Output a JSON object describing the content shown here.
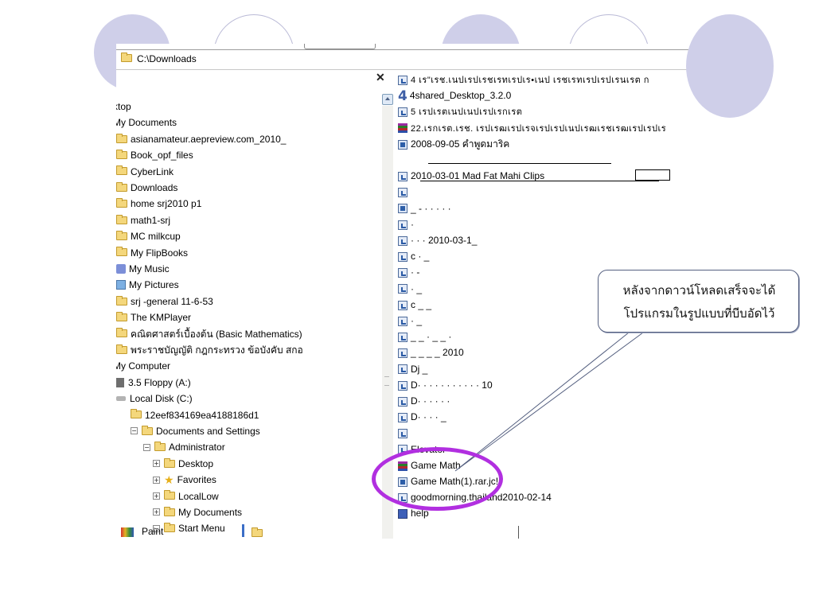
{
  "address_bar": {
    "path": "C:\\Downloads"
  },
  "left_pane": {
    "close_label": "✕",
    "tree": [
      {
        "label": "ktop",
        "icon": "none",
        "indent": 0
      },
      {
        "label": "My Documents",
        "icon": "none",
        "indent": 0
      },
      {
        "label": "asianamateur.aepreview.com_2010_",
        "icon": "folder-icon",
        "indent": 1
      },
      {
        "label": "Book_opf_files",
        "icon": "folder-icon",
        "indent": 1
      },
      {
        "label": "CyberLink",
        "icon": "folder-icon",
        "indent": 1
      },
      {
        "label": "Downloads",
        "icon": "folder-icon",
        "indent": 1
      },
      {
        "label": "home srj2010 p1",
        "icon": "folder-icon",
        "indent": 1
      },
      {
        "label": "math1-srj",
        "icon": "folder-icon",
        "indent": 1
      },
      {
        "label": "MC milkcup",
        "icon": "folder-icon",
        "indent": 1
      },
      {
        "label": "My FlipBooks",
        "icon": "folder-icon",
        "indent": 1
      },
      {
        "label": "My Music",
        "icon": "music-folder-icon",
        "indent": 1
      },
      {
        "label": "My Pictures",
        "icon": "pictures-folder-icon",
        "indent": 1
      },
      {
        "label": "srj -general 11-6-53",
        "icon": "folder-icon",
        "indent": 1
      },
      {
        "label": "The KMPlayer",
        "icon": "folder-icon",
        "indent": 1
      },
      {
        "label": "คณิตศาสตร์เบื้องต้น (Basic Mathematics)",
        "icon": "folder-icon",
        "indent": 1
      },
      {
        "label": "พระราชบัญญัติ  กฎกระทรวง  ข้อบังคับ สกอ",
        "icon": "folder-icon",
        "indent": 1
      },
      {
        "label": "My Computer",
        "icon": "none",
        "indent": 0
      },
      {
        "label": "3.5 Floppy (A:)",
        "icon": "floppy-icon",
        "indent": 1
      },
      {
        "label": "Local Disk (C:)",
        "icon": "disk-icon",
        "indent": 1
      },
      {
        "label": "12eef834169ea4188186d1",
        "icon": "folder-icon",
        "indent": 2
      },
      {
        "label": "Documents and Settings",
        "icon": "folder-icon",
        "indent": 2,
        "expander": "−"
      },
      {
        "label": "Administrator",
        "icon": "folder-icon",
        "indent": 3,
        "expander": "−"
      },
      {
        "label": "Desktop",
        "icon": "folder-icon",
        "indent": 4,
        "expander": "+"
      },
      {
        "label": "Favorites",
        "icon": "star-icon",
        "indent": 4,
        "expander": "+"
      },
      {
        "label": "LocalLow",
        "icon": "folder-icon",
        "indent": 4,
        "expander": "+"
      },
      {
        "label": "My Documents",
        "icon": "folder-icon",
        "indent": 4,
        "expander": "+"
      },
      {
        "label": "Start Menu",
        "icon": "folder-icon",
        "indent": 4,
        "expander": "−"
      }
    ]
  },
  "right_pane": {
    "files": [
      {
        "label": "4 เร\"เรช.เนปเรปเรชเรทเรปเร•เนป เรชเรทเรปเรปเรนเรต ก",
        "icon": "media-icon",
        "garbled": true
      },
      {
        "label": "4shared_Desktop_3.2.0",
        "icon": "4shared-icon"
      },
      {
        "label": "5 เรปเรตเนปเนปเรปเรกเรต",
        "icon": "media-icon",
        "garbled": true
      },
      {
        "label": "22.เรกเรต.เรช. เรปเรฒเรปเรจเรปเรปเนปเรฒเรชเรฒเรปเรปเร",
        "icon": "rar-icon",
        "garbled": true
      },
      {
        "label": "2008-09-05 คำพูดมาริค",
        "icon": "film-icon"
      },
      {
        "label": "",
        "icon": "none"
      },
      {
        "label": "2010-03-01 Mad Fat Mahi Clips",
        "icon": "media-icon"
      },
      {
        "label": "",
        "icon": "media-icon"
      },
      {
        "label": "_   -   ·   · · ·  ·",
        "icon": "film-icon"
      },
      {
        "label": "·",
        "icon": "media-icon"
      },
      {
        "label": "·       · · 2010-03-1_",
        "icon": "media-icon"
      },
      {
        "label": "c  ·  _",
        "icon": "media-icon"
      },
      {
        "label": "·      -",
        "icon": "media-icon"
      },
      {
        "label": "·                         _",
        "icon": "media-icon"
      },
      {
        "label": "c    _           _",
        "icon": "media-icon"
      },
      {
        "label": "·     _",
        "icon": "media-icon"
      },
      {
        "label": "_  _  ·  _  _    ·",
        "icon": "media-icon"
      },
      {
        "label": "_ _  _  _ 2010",
        "icon": "media-icon"
      },
      {
        "label": "Dj              _",
        "icon": "media-icon"
      },
      {
        "label": "D·  ·       · ·   ·  ·  ·  ·  ·  ·  ·  10",
        "icon": "media-icon"
      },
      {
        "label": "D·   ·   ·  ·  ·    ·",
        "icon": "media-icon"
      },
      {
        "label": "D·  ·   ·  ·   _",
        "icon": "media-icon"
      },
      {
        "label": "",
        "icon": "media-icon"
      },
      {
        "label": "Elevator",
        "icon": "media-icon"
      },
      {
        "label": "Game Math",
        "icon": "rar-icon"
      },
      {
        "label": "Game Math(1).rar.jc!",
        "icon": "film-icon"
      },
      {
        "label": "goodmorning.thailand2010-02-14",
        "icon": "media-icon"
      },
      {
        "label": "help",
        "icon": "doc-icon"
      }
    ]
  },
  "bottom_bar": {
    "paint_label": "Paint",
    "folder_label": ""
  },
  "callout": {
    "line1": "หลังจากดาวน์โหลดเสร็จจะได้",
    "line2": "โปรแกรมในรูปแบบที่บีบอัดไว้"
  },
  "colors": {
    "deco_circle": "#cfcfe9",
    "highlight": "#b12fe0",
    "callout_border": "#556080"
  }
}
